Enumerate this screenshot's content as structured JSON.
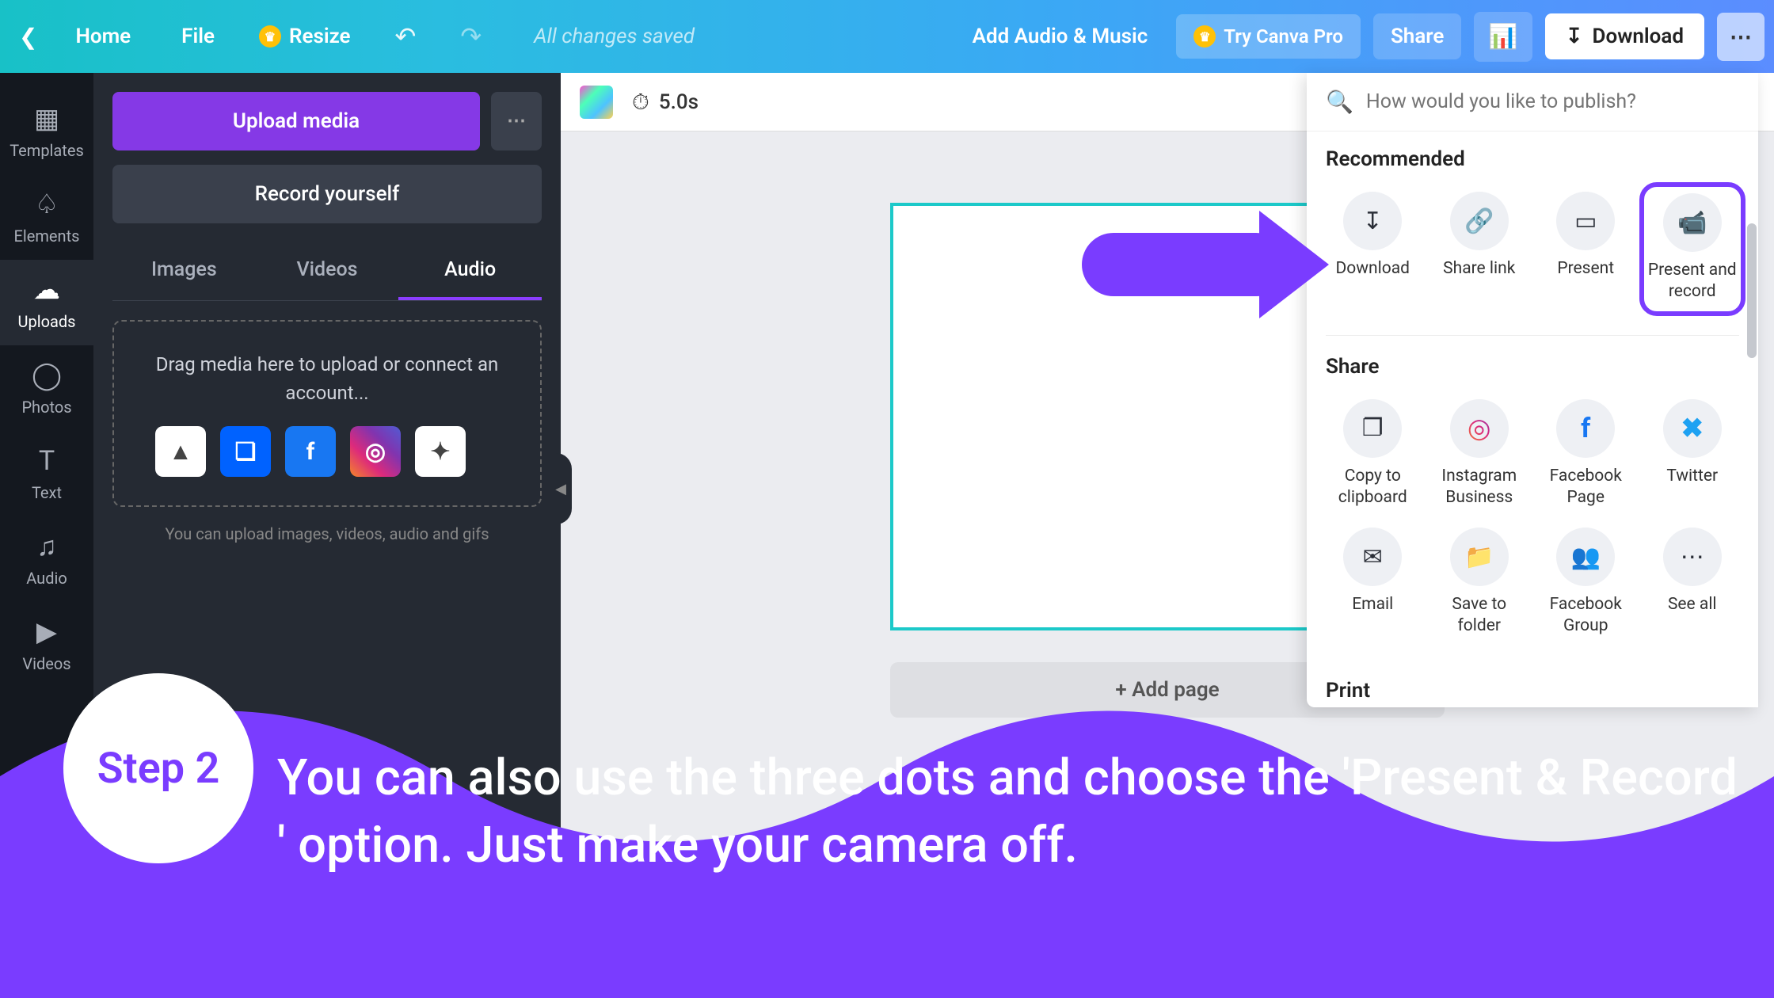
{
  "topbar": {
    "home": "Home",
    "file": "File",
    "resize": "Resize",
    "saved": "All changes saved",
    "audio_music": "Add Audio & Music",
    "try_pro": "Try Canva Pro",
    "share": "Share",
    "download": "Download"
  },
  "leftnav": [
    {
      "label": "Templates"
    },
    {
      "label": "Elements"
    },
    {
      "label": "Uploads"
    },
    {
      "label": "Photos"
    },
    {
      "label": "Text"
    },
    {
      "label": "Audio"
    },
    {
      "label": "Videos"
    }
  ],
  "sidepanel": {
    "upload_media": "Upload media",
    "record": "Record yourself",
    "tabs": {
      "images": "Images",
      "videos": "Videos",
      "audio": "Audio"
    },
    "drop_text": "Drag media here to upload or connect an account...",
    "hint": "You can upload images, videos, audio and gifs"
  },
  "canvas": {
    "duration": "5.0s",
    "add_page": "+ Add page"
  },
  "publish": {
    "search_placeholder": "How would you like to publish?",
    "recommended_title": "Recommended",
    "recommended": [
      {
        "label": "Download"
      },
      {
        "label": "Share link"
      },
      {
        "label": "Present"
      },
      {
        "label": "Present and record"
      }
    ],
    "share_title": "Share",
    "share_row1": [
      {
        "label": "Copy to clipboard"
      },
      {
        "label": "Instagram Business"
      },
      {
        "label": "Facebook Page"
      },
      {
        "label": "Twitter"
      }
    ],
    "share_row2": [
      {
        "label": "Email"
      },
      {
        "label": "Save to folder"
      },
      {
        "label": "Facebook Group"
      },
      {
        "label": "See all"
      }
    ],
    "print_title": "Print"
  },
  "annotation": {
    "step": "Step 2",
    "text": "You can also use the three dots and choose the 'Present & Record ' option. Just make your camera off."
  }
}
